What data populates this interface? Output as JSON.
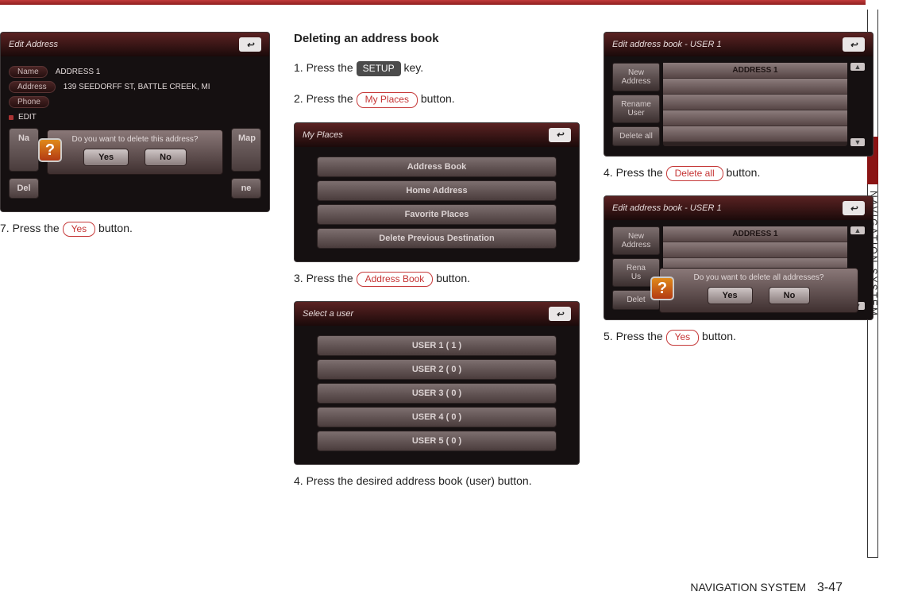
{
  "section_tab": "NAVIGATION SYSTEM",
  "footer": {
    "section": "NAVIGATION SYSTEM",
    "page": "3-47"
  },
  "left": {
    "screen1": {
      "title": "Edit Address",
      "btn_name": "Name",
      "btn_address": "Address",
      "btn_phone": "Phone",
      "val_name": "ADDRESS 1",
      "val_address": "139 SEEDORFF ST, BATTLE CREEK, MI",
      "edit_label": "EDIT",
      "row_na": "Na",
      "row_del": "Del",
      "row_map": "Map",
      "row_ne": "ne",
      "dlg_text": "Do you want to delete this address?",
      "dlg_yes": "Yes",
      "dlg_no": "No"
    },
    "step7_pre": "7. Press the ",
    "step7_btn": "Yes",
    "step7_post": " button."
  },
  "mid": {
    "heading": "Deleting an address book",
    "step1_pre": "1. Press the ",
    "step1_key": "SETUP",
    "step1_post": " key.",
    "step2_pre": "2. Press the ",
    "step2_btn": "My Places",
    "step2_post": " button.",
    "screen_myplaces": {
      "title": "My Places",
      "items": [
        "Address Book",
        "Home Address",
        "Favorite Places",
        "Delete Previous Destination"
      ]
    },
    "step3_pre": "3. Press the ",
    "step3_btn": "Address Book",
    "step3_post": " button.",
    "screen_users": {
      "title": "Select a user",
      "items": [
        "USER 1 ( 1 )",
        "USER 2 ( 0 )",
        "USER 3 ( 0 )",
        "USER 4 ( 0 )",
        "USER 5 ( 0 )"
      ]
    },
    "step4": "4. Press the desired address book (user) button."
  },
  "right": {
    "screen_book": {
      "title": "Edit address book - USER 1",
      "new_addr": "New Address",
      "rename": "Rename User",
      "delete_all": "Delete all",
      "entry1": "ADDRESS 1"
    },
    "step4_pre": "4. Press the ",
    "step4_btn": "Delete all",
    "step4_post": " button.",
    "screen_confirm": {
      "title": "Edit address book - USER 1",
      "new_addr": "New Address",
      "rena": "Rena",
      "us": "Us",
      "delet": "Delet",
      "entry1": "ADDRESS 1",
      "dlg_text": "Do you want to delete all addresses?",
      "dlg_yes": "Yes",
      "dlg_no": "No"
    },
    "step5_pre": "5. Press the ",
    "step5_btn": "Yes",
    "step5_post": " button."
  }
}
